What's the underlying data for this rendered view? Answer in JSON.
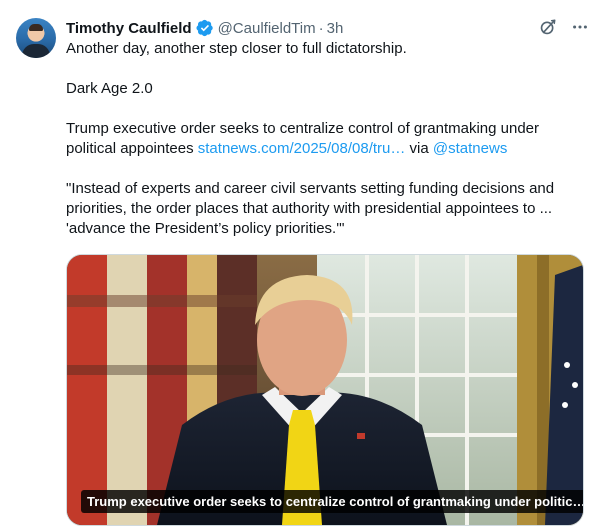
{
  "author": {
    "name": "Timothy Caulfield",
    "handle": "@CaulfieldTim",
    "time": "3h",
    "separator": "·"
  },
  "post": {
    "line1": "Another day, another step closer to full dictatorship.",
    "line2": "Dark Age 2.0",
    "line3a": "Trump executive order seeks to centralize control of grantmaking under",
    "line3b": "political appointees ",
    "link": "statnews.com/2025/08/08/tru…",
    "via": " via ",
    "mention": "@statnews",
    "quote1": "\"Instead of experts and career civil servants setting funding decisions and",
    "quote2": "priorities, the order places that authority with presidential appointees to ...",
    "quote3": "'advance the President’s policy priorities.'\""
  },
  "media": {
    "caption": "Trump executive order seeks to centralize control of grantmaking under politic…"
  },
  "icons": {
    "verified": "verified-badge-icon",
    "grok": "grok-icon",
    "more": "more-icon"
  },
  "colors": {
    "link": "#1d9bf0",
    "secondary_text": "#536471",
    "verified": "#1d9bf0"
  }
}
